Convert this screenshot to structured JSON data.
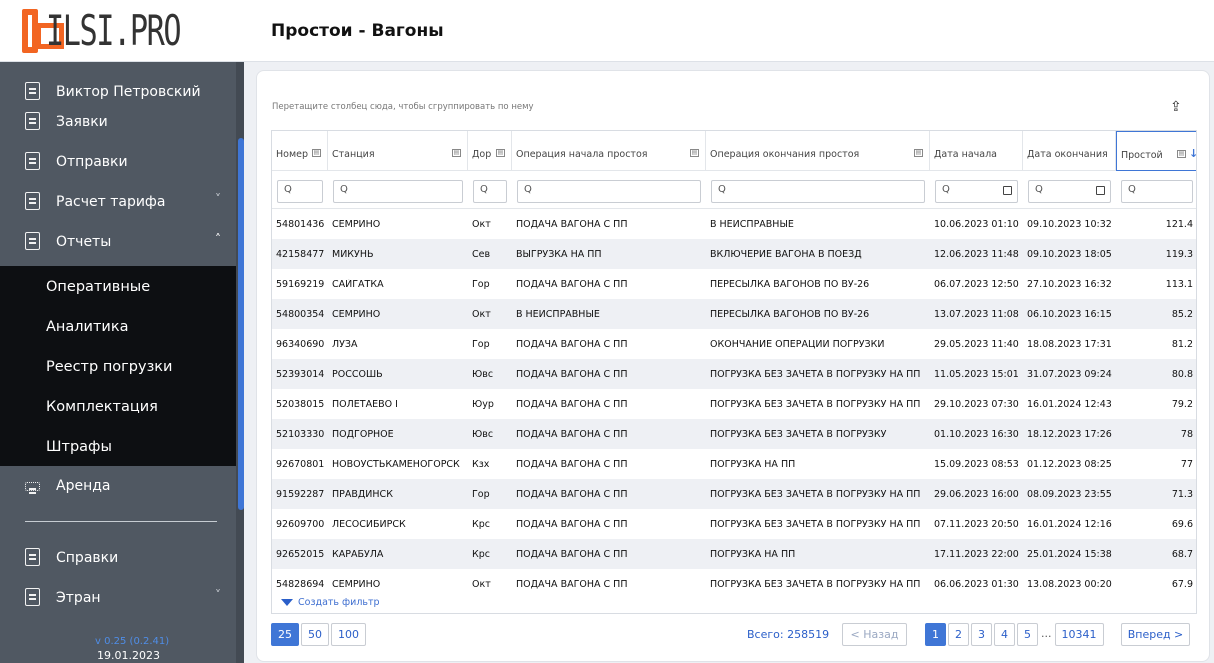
{
  "brand": {
    "logo_text": "ILSI.PRO",
    "accent": "#f26522"
  },
  "page_title": "Простои - Вагоны",
  "sidebar": {
    "items": [
      {
        "label": "Виктор Петровский",
        "icon": "document-icon"
      },
      {
        "label": "Заявки",
        "icon": "checklist-icon"
      },
      {
        "label": "Отправки",
        "icon": "send-doc-icon"
      },
      {
        "label": "Расчет тарифа",
        "icon": "calculator-icon",
        "chevron": "˅"
      },
      {
        "label": "Отчеты",
        "icon": "report-icon",
        "chevron": "˄"
      }
    ],
    "sub_items": [
      "Оперативные",
      "Аналитика",
      "Реестр погрузки",
      "Комплектация",
      "Штрафы"
    ],
    "lower_items": [
      {
        "label": "Аренда",
        "icon": "wagon-icon"
      },
      {
        "label": "Справки",
        "icon": "report-icon"
      },
      {
        "label": "Этран",
        "icon": "report-icon",
        "chevron": "˅"
      }
    ],
    "version": "v 0.25 (0.2.41)",
    "version_date": "19.01.2023"
  },
  "grid": {
    "group_hint": "Перетащите столбец сюда, чтобы сгруппировать по нему",
    "columns": [
      "Номер",
      "Станция",
      "Дор",
      "Операция начала простоя",
      "Операция окончания простоя",
      "Дата начала",
      "Дата окончания",
      "Простой"
    ],
    "filter_placeholder": "Q",
    "rows": [
      [
        "54801436",
        "СЕМРИНО",
        "Окт",
        "ПОДАЧА ВАГОНА С ПП",
        "В НЕИСПРАВНЫЕ",
        "10.06.2023 01:10",
        "09.10.2023 10:32",
        "121.4"
      ],
      [
        "42158477",
        "МИКУНЬ",
        "Сев",
        "ВЫГРУЗКА НА ПП",
        "ВКЛЮЧЕРИЕ ВАГОНА В ПОЕЗД",
        "12.06.2023 11:48",
        "09.10.2023 18:05",
        "119.3"
      ],
      [
        "59169219",
        "САЙГАТКА",
        "Гор",
        "ПОДАЧА ВАГОНА С ПП",
        "ПЕРЕСЫЛКА ВАГОНОВ ПО ВУ-26",
        "06.07.2023 12:50",
        "27.10.2023 16:32",
        "113.1"
      ],
      [
        "54800354",
        "СЕМРИНО",
        "Окт",
        "В НЕИСПРАВНЫЕ",
        "ПЕРЕСЫЛКА ВАГОНОВ ПО ВУ-26",
        "13.07.2023 11:08",
        "06.10.2023 16:15",
        "85.2"
      ],
      [
        "96340690",
        "ЛУЗА",
        "Гор",
        "ПОДАЧА ВАГОНА С ПП",
        "ОКОНЧАНИЕ ОПЕРАЦИИ ПОГРУЗКИ",
        "29.05.2023 11:40",
        "18.08.2023 17:31",
        "81.2"
      ],
      [
        "52393014",
        "РОССОШЬ",
        "Ювс",
        "ПОДАЧА ВАГОНА С ПП",
        "ПОГРУЗКА БЕЗ ЗАЧЕТА В ПОГРУЗКУ НА ПП",
        "11.05.2023 15:01",
        "31.07.2023 09:24",
        "80.8"
      ],
      [
        "52038015",
        "ПОЛЕТАЕВО I",
        "Юур",
        "ПОДАЧА ВАГОНА С ПП",
        "ПОГРУЗКА БЕЗ ЗАЧЕТА В ПОГРУЗКУ НА ПП",
        "29.10.2023 07:30",
        "16.01.2024 12:43",
        "79.2"
      ],
      [
        "52103330",
        "ПОДГОРНОЕ",
        "Ювс",
        "ПОДАЧА ВАГОНА С ПП",
        "ПОГРУЗКА БЕЗ ЗАЧЕТА В ПОГРУЗКУ",
        "01.10.2023 16:30",
        "18.12.2023 17:26",
        "78"
      ],
      [
        "92670801",
        "НОВОУСТЬКАМЕНОГОРСК",
        "Кзх",
        "ПОДАЧА ВАГОНА С ПП",
        "ПОГРУЗКА НА ПП",
        "15.09.2023 08:53",
        "01.12.2023 08:25",
        "77"
      ],
      [
        "91592287",
        "ПРАВДИНСК",
        "Гор",
        "ПОДАЧА ВАГОНА С ПП",
        "ПОГРУЗКА БЕЗ ЗАЧЕТА В ПОГРУЗКУ НА ПП",
        "29.06.2023 16:00",
        "08.09.2023 23:55",
        "71.3"
      ],
      [
        "92609700",
        "ЛЕСОСИБИРСК",
        "Крс",
        "ПОДАЧА ВАГОНА С ПП",
        "ПОГРУЗКА БЕЗ ЗАЧЕТА В ПОГРУЗКУ НА ПП",
        "07.11.2023 20:50",
        "16.01.2024 12:16",
        "69.6"
      ],
      [
        "92652015",
        "КАРАБУЛА",
        "Крс",
        "ПОДАЧА ВАГОНА С ПП",
        "ПОГРУЗКА НА ПП",
        "17.11.2023 22:00",
        "25.01.2024 15:38",
        "68.7"
      ],
      [
        "54828694",
        "СЕМРИНО",
        "Окт",
        "ПОДАЧА ВАГОНА С ПП",
        "ПОГРУЗКА БЕЗ ЗАЧЕТА В ПОГРУЗКУ НА ПП",
        "06.06.2023 01:30",
        "13.08.2023 00:20",
        "67.9"
      ]
    ],
    "create_filter": "Создать фильтр"
  },
  "pager": {
    "sizes": [
      "25",
      "50",
      "100"
    ],
    "selected_size": "25",
    "total": "Всего: 258519",
    "prev": "< Назад",
    "pages": [
      "1",
      "2",
      "3",
      "4",
      "5",
      "...",
      "10341"
    ],
    "current_page": "1",
    "next": "Вперед >"
  },
  "colors": {
    "sidebar": "#505862",
    "submenu": "#0d0f12",
    "primary": "#3f76d6"
  }
}
